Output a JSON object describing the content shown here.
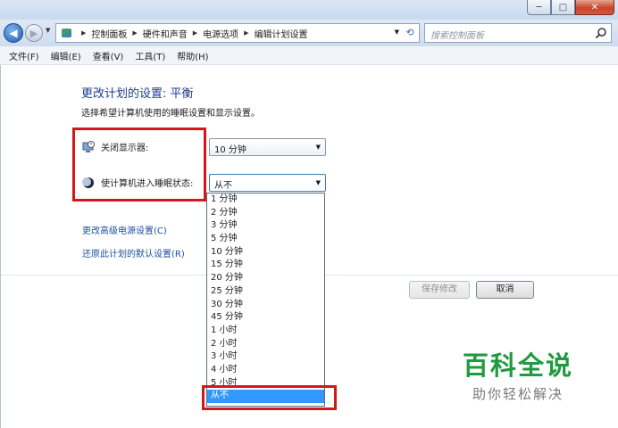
{
  "window": {
    "minimize_glyph": "─",
    "maximize_glyph": "□",
    "close_glyph": "✕"
  },
  "address_bar": {
    "back_glyph": "◀",
    "forward_glyph": "▶",
    "breadcrumbs": [
      "控制面板",
      "硬件和声音",
      "电源选项",
      "编辑计划设置"
    ],
    "search_placeholder": "搜索控制面板"
  },
  "menu": [
    "文件(F)",
    "编辑(E)",
    "查看(V)",
    "工具(T)",
    "帮助(H)"
  ],
  "page": {
    "title": "更改计划的设置: 平衡",
    "subtitle": "选择希望计算机使用的睡眠设置和显示设置。",
    "display_off": {
      "label": "关闭显示器:",
      "value": "10 分钟"
    },
    "sleep": {
      "label": "使计算机进入睡眠状态:",
      "value": "从不"
    },
    "links": [
      "更改高级电源设置(C)",
      "还原此计划的默认设置(R)"
    ],
    "buttons": {
      "save": "保存修改",
      "cancel": "取消"
    }
  },
  "sleep_options": [
    "1 分钟",
    "2 分钟",
    "3 分钟",
    "5 分钟",
    "10 分钟",
    "15 分钟",
    "20 分钟",
    "25 分钟",
    "30 分钟",
    "45 分钟",
    "1 小时",
    "2 小时",
    "3 小时",
    "4 小时",
    "5 小时",
    "从不"
  ],
  "selected_option": "从不",
  "watermark": {
    "title": "百科全说",
    "subtitle": "助你轻松解决"
  },
  "colors": {
    "highlight": "#d5171c",
    "selection": "#3399ff",
    "title": "#1f3b8c",
    "link": "#1f4fa3",
    "watermark": "#1f9a3e"
  }
}
